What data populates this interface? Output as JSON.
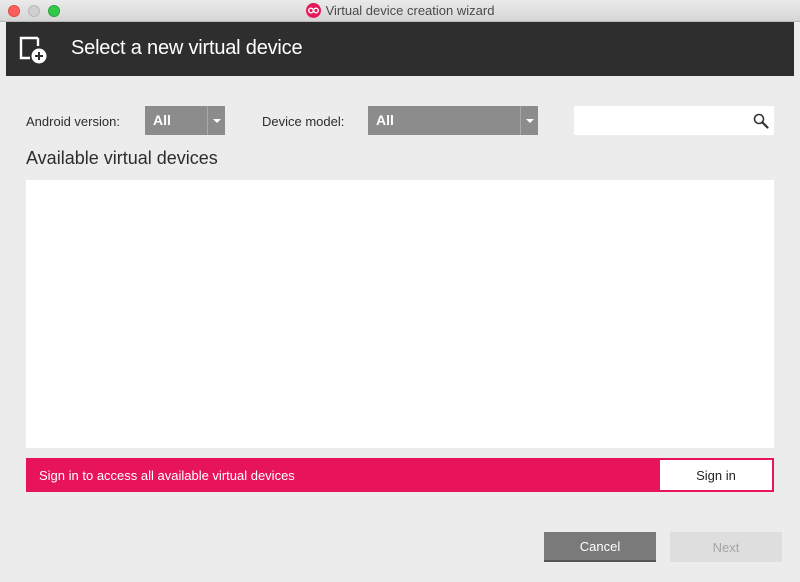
{
  "window": {
    "title": "Virtual device creation wizard",
    "app_icon": "genymotion-icon"
  },
  "header": {
    "title": "Select a new virtual device",
    "icon": "add-device-icon"
  },
  "filters": {
    "android_version_label": "Android version:",
    "android_version_value": "All",
    "device_model_label": "Device model:",
    "device_model_value": "All",
    "search_value": "",
    "search_placeholder": ""
  },
  "list": {
    "title": "Available virtual devices",
    "items": []
  },
  "signin": {
    "message": "Sign in to access all available virtual devices",
    "button_label": "Sign in"
  },
  "footer": {
    "cancel_label": "Cancel",
    "next_label": "Next"
  },
  "colors": {
    "accent": "#e8145b",
    "header_bg": "#2e2e2e",
    "window_bg": "#ececec"
  }
}
